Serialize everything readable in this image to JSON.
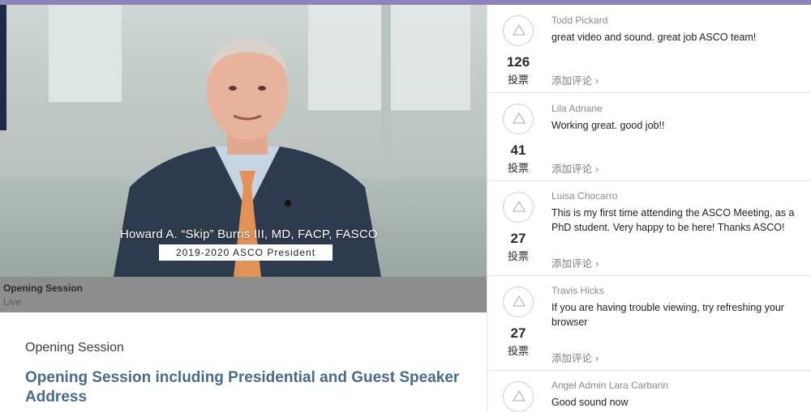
{
  "video": {
    "caption_name": "Howard A. “Skip” Burris III, MD, FACP, FASCO",
    "caption_title": "2019-2020 ASCO President",
    "status_title": "Opening Session",
    "status_live": "Live"
  },
  "session": {
    "label": "Opening Session",
    "heading": "Opening Session including Presidential and Guest Speaker Address"
  },
  "comments": [
    {
      "author": "Todd Pickard",
      "text": "great video and sound. great job ASCO team!",
      "votes": "126",
      "vote_label": "投票",
      "add_comment": "添加评论"
    },
    {
      "author": "Lila Adnane",
      "text": "Working great. good job!!",
      "votes": "41",
      "vote_label": "投票",
      "add_comment": "添加评论"
    },
    {
      "author": "Luisa Chocarro",
      "text": "This is my first time attending the ASCO Meeting, as a PhD student. Very happy to be here! Thanks ASCO!",
      "votes": "27",
      "vote_label": "投票",
      "add_comment": "添加评论"
    },
    {
      "author": "Travis Hicks",
      "text": "If you are having trouble viewing, try refreshing your browser",
      "votes": "27",
      "vote_label": "投票",
      "add_comment": "添加评论"
    },
    {
      "author": "Angel Admin Lara Carbarin",
      "text": "Good sound now",
      "votes": "",
      "vote_label": "",
      "add_comment": ""
    }
  ],
  "icons": {
    "upvote": "triangle-up-outline-icon",
    "chevron": "chevron-right-icon"
  },
  "colors": {
    "top_strip": "#8f84b9",
    "heading": "#4a6b87"
  }
}
